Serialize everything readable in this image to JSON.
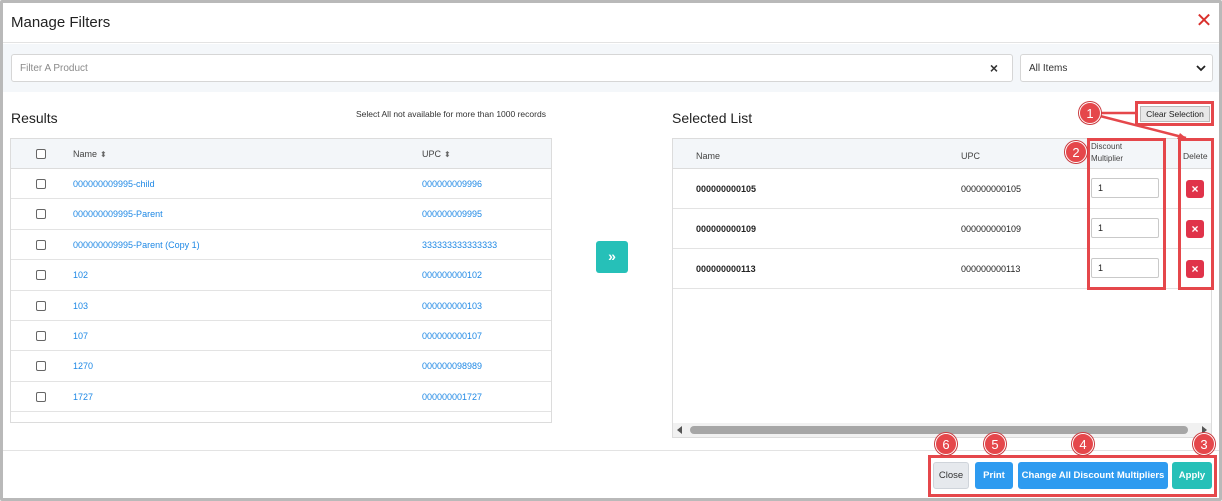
{
  "dialog": {
    "title": "Manage Filters"
  },
  "filter": {
    "placeholder": "Filter A Product",
    "clear_glyph": "×",
    "select_value": "All Items"
  },
  "results": {
    "title": "Results",
    "note": "Select All not available for more than 1000 records",
    "headers": {
      "name": "Name",
      "upc": "UPC"
    },
    "rows": [
      {
        "name": "000000009995-child",
        "upc": "000000009996"
      },
      {
        "name": "000000009995-Parent",
        "upc": "000000009995"
      },
      {
        "name": "000000009995-Parent (Copy 1)",
        "upc": "333333333333333"
      },
      {
        "name": "102",
        "upc": "000000000102"
      },
      {
        "name": "103",
        "upc": "000000000103"
      },
      {
        "name": "107",
        "upc": "000000000107"
      },
      {
        "name": "1270",
        "upc": "000000098989"
      },
      {
        "name": "1727",
        "upc": "000000001727"
      }
    ]
  },
  "move_button": {
    "glyph": "»"
  },
  "selected": {
    "title": "Selected List",
    "clear_label": "Clear Selection",
    "headers": {
      "name": "Name",
      "upc": "UPC",
      "multiplier_line1": "Discount",
      "multiplier_line2": "Multiplier",
      "delete": "Delete"
    },
    "rows": [
      {
        "name": "000000000105",
        "upc": "000000000105",
        "multiplier": "1"
      },
      {
        "name": "000000000109",
        "upc": "000000000109",
        "multiplier": "1"
      },
      {
        "name": "000000000113",
        "upc": "000000000113",
        "multiplier": "1"
      }
    ],
    "delete_glyph": "×"
  },
  "footer": {
    "close_label": "Close",
    "print_label": "Print",
    "change_label": "Change All Discount Multipliers",
    "apply_label": "Apply"
  },
  "annotations": [
    "1",
    "2",
    "3",
    "4",
    "5",
    "6"
  ],
  "colors": {
    "accent_blue": "#2e9bf0",
    "teal": "#26c0b8",
    "annotation_red": "#e5474b",
    "link": "#1e88e5"
  },
  "icons": {
    "close": "close-icon",
    "sort": "sort-icon",
    "move_right": "double-chevron-right-icon",
    "delete": "delete-icon",
    "dropdown": "chevron-down-icon"
  }
}
